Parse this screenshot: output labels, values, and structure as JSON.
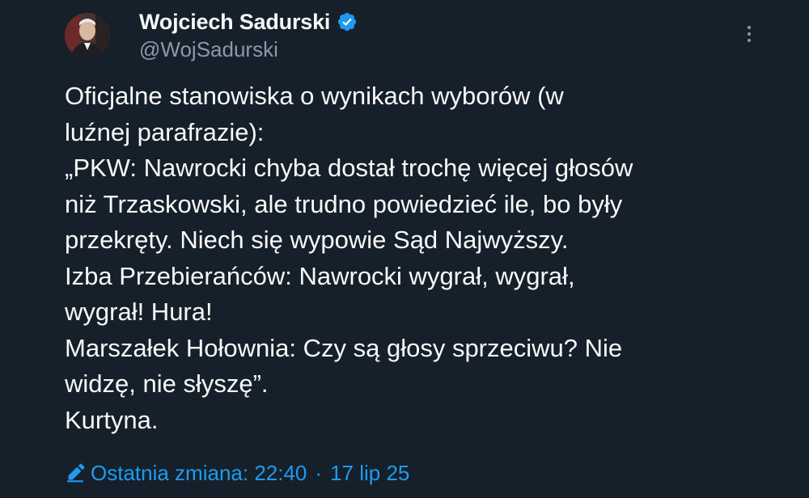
{
  "author": {
    "display_name": "Wojciech Sadurski",
    "handle": "@WojSadurski",
    "verified_icon": "verified-badge-icon",
    "verified_color": "#1d9bf0"
  },
  "tweet": {
    "lines": [
      "Oficjalne stanowiska o wynikach wyborów (w",
      "luźnej parafrazie):",
      "„PKW: Nawrocki chyba dostał trochę więcej głosów",
      "niż Trzaskowski, ale trudno powiedzieć ile, bo były",
      "przekręty. Niech się wypowie Sąd Najwyższy.",
      "Izba Przebierańców: Nawrocki wygrał, wygrał,",
      "wygrał! Hura!",
      "Marszałek Hołownia: Czy są głosy sprzeciwu? Nie",
      "widzę, nie słyszę”.",
      "Kurtyna."
    ]
  },
  "edit_info": {
    "label": "Ostatnia zmiana: 22:40",
    "separator": "·",
    "date": "17 lip 25",
    "icon": "pencil-icon"
  },
  "colors": {
    "background": "#15202b",
    "text": "#f7f9f9",
    "secondary": "#8b98a5",
    "accent": "#1d9bf0"
  }
}
